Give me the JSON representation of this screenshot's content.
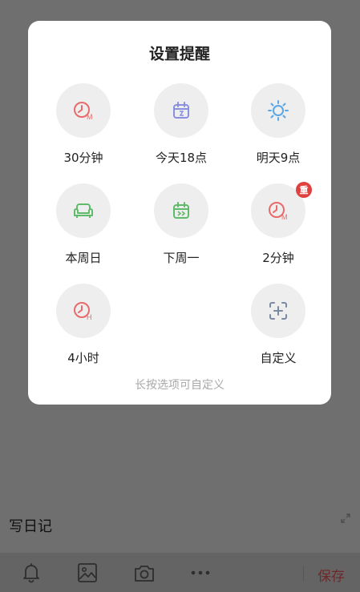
{
  "dialog": {
    "title": "设置提醒",
    "options": [
      {
        "label": "30分钟",
        "icon": "clock-m-icon",
        "color": "#e86a6a"
      },
      {
        "label": "今天18点",
        "icon": "calendar-today-icon",
        "color": "#8b8fe0"
      },
      {
        "label": "明天9点",
        "icon": "sun-icon",
        "color": "#5aa6e6"
      },
      {
        "label": "本周日",
        "icon": "sofa-icon",
        "color": "#5fba6a"
      },
      {
        "label": "下周一",
        "icon": "calendar-next-icon",
        "color": "#5fba6a"
      },
      {
        "label": "2分钟",
        "icon": "clock-m-icon",
        "color": "#e86a6a",
        "badge": "重"
      },
      {
        "label": "4小时",
        "icon": "clock-h-icon",
        "color": "#e86a6a"
      },
      {
        "label": "自定义",
        "icon": "custom-add-icon",
        "color": "#7a8aa0"
      }
    ],
    "hint": "长按选项可自定义"
  },
  "editor": {
    "placeholder_text": "写日记"
  },
  "toolbar": {
    "icons": [
      "bell-icon",
      "image-icon",
      "camera-icon",
      "more-icon"
    ],
    "save_label": "保存",
    "save_color": "#6e2a2a"
  }
}
